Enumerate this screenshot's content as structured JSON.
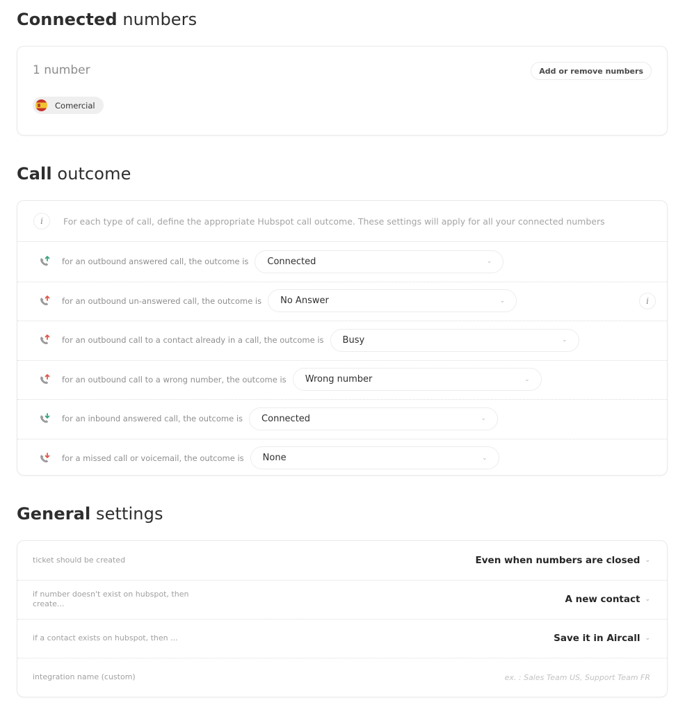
{
  "connected_numbers": {
    "title_strong": "Connected",
    "title_light": "numbers",
    "count_label": "1 number",
    "add_button_label": "Add or remove numbers",
    "numbers": [
      {
        "name": "Comercial",
        "flag": "spain-flag-icon"
      }
    ]
  },
  "call_outcome": {
    "title_strong": "Call",
    "title_light": "outcome",
    "info_text": "For each type of call, define the appropriate Hubspot call outcome. These settings will apply for all your connected numbers",
    "info_icon": "info-icon",
    "rows": [
      {
        "label": "for an outbound answered call, the outcome is",
        "value": "Connected",
        "icon": "outbound-call-icon",
        "arrow_color": "#3aa57a"
      },
      {
        "label": "for an outbound un-answered call, the outcome is",
        "value": "No Answer",
        "icon": "outbound-call-icon",
        "arrow_color": "#e0574a"
      },
      {
        "label": "for an outbound call to a contact already in a call, the outcome is",
        "value": "Busy",
        "icon": "outbound-call-icon",
        "arrow_color": "#e0574a"
      },
      {
        "label": "for an outbound call to a wrong number, the outcome is",
        "value": "Wrong number",
        "icon": "outbound-call-icon",
        "arrow_color": "#e0574a"
      },
      {
        "label": "for an inbound answered call, the outcome is",
        "value": "Connected",
        "icon": "inbound-call-icon",
        "arrow_color": "#3aa57a"
      },
      {
        "label": "for a missed call or voicemail, the outcome is",
        "value": "None",
        "icon": "inbound-call-icon",
        "arrow_color": "#e0574a"
      }
    ]
  },
  "general_settings": {
    "title_strong": "General",
    "title_light": "settings",
    "rows": [
      {
        "label": "ticket should be created",
        "value": "Even when numbers are closed"
      },
      {
        "label": "if number doesn't exist on hubspot, then create...",
        "value": "A new contact"
      },
      {
        "label": "if a contact exists on hubspot, then ...",
        "value": "Save it in Aircall"
      }
    ],
    "integration_name": {
      "label": "integration name (custom)",
      "value": "",
      "placeholder": "ex. : Sales Team US, Support Team FR"
    }
  },
  "icons": {
    "chevron": "⌄",
    "info": "i"
  }
}
